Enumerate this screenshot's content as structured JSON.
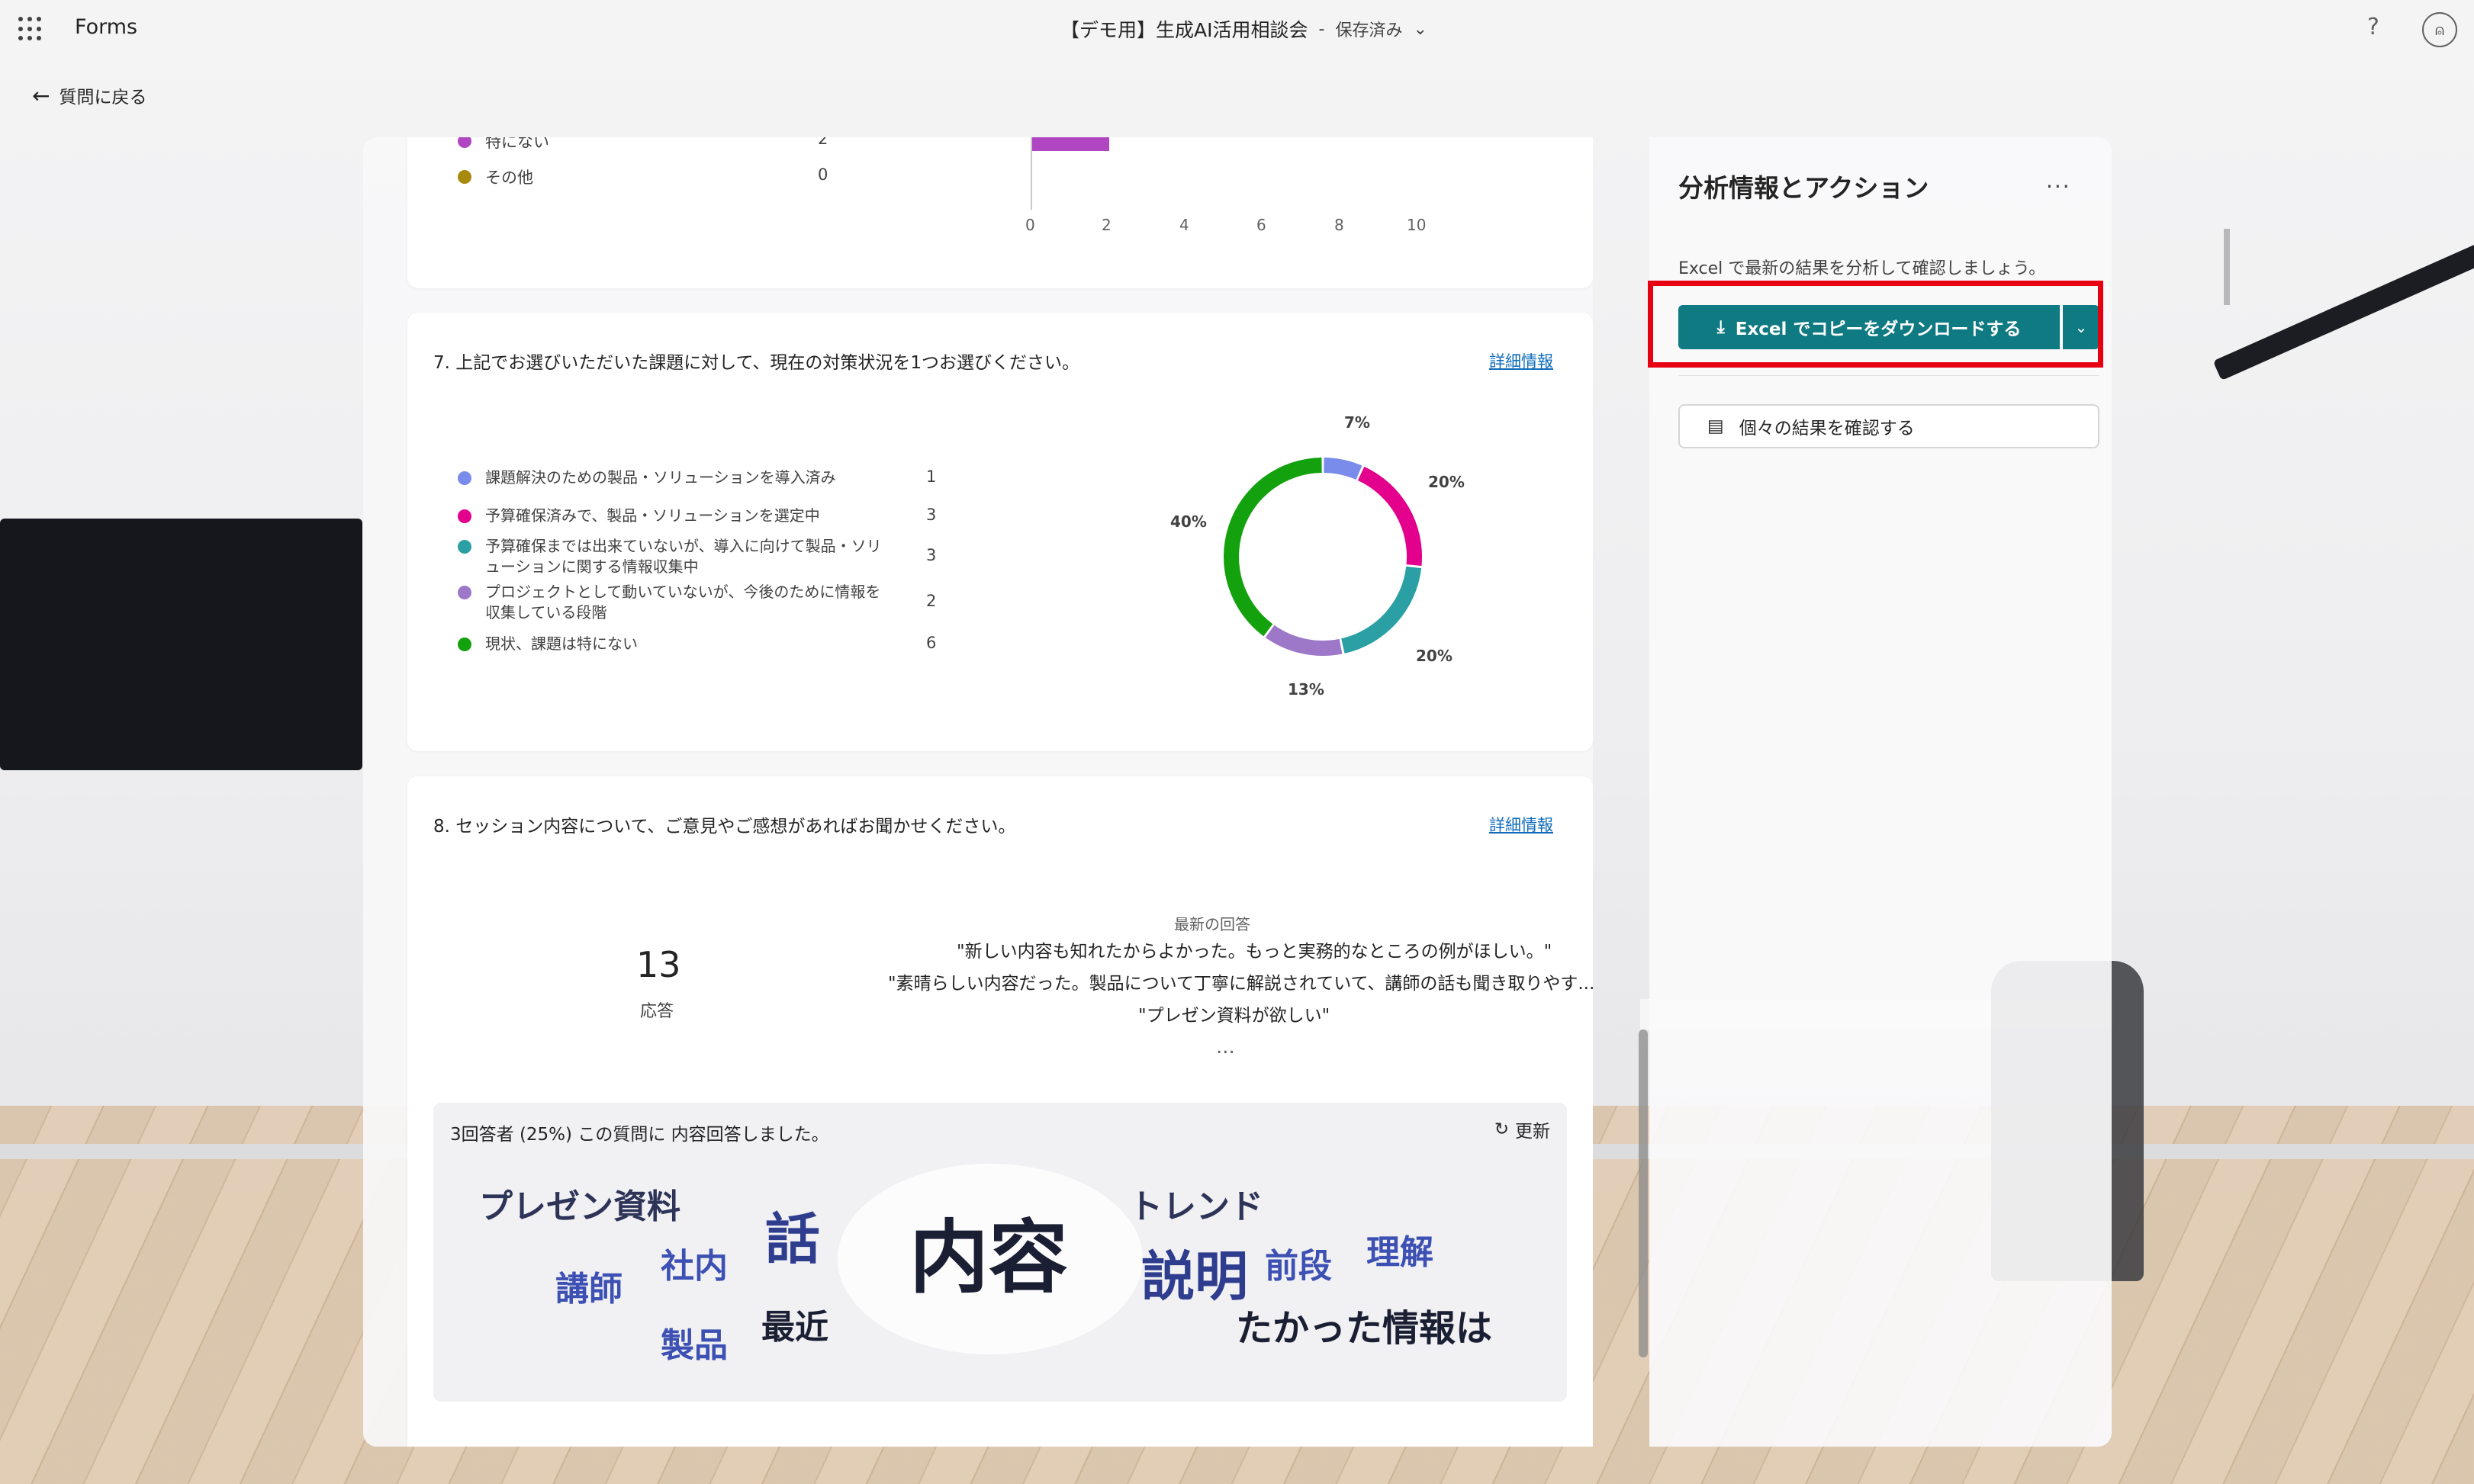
{
  "app": {
    "name": "Forms",
    "document_title": "【デモ用】生成AI活用相談会",
    "separator": "-",
    "save_status": "保存済み",
    "help_icon": "question-icon",
    "avatar_icon": "user-avatar-icon"
  },
  "nav": {
    "back_label": "質問に戻る"
  },
  "q6": {
    "legend": [
      {
        "label": "特にない",
        "count": "2",
        "color": "#b146c2"
      },
      {
        "label": "その他",
        "count": "0",
        "color": "#a7890c"
      }
    ],
    "axis_ticks": [
      "0",
      "2",
      "4",
      "6",
      "8",
      "10"
    ],
    "bar_value": 2,
    "bar_max": 10,
    "bar_color": "#b146c2"
  },
  "q7": {
    "title": "7. 上記でお選びいただいた課題に対して、現在の対策状況を1つお選びください。",
    "detail_link": "詳細情報",
    "legend": [
      {
        "label": "課題解決のための製品・ソリューションを導入済み",
        "count": "1",
        "color": "#7a8ceb"
      },
      {
        "label": "予算確保済みで、製品・ソリューションを選定中",
        "count": "3",
        "color": "#e3008c"
      },
      {
        "label": "予算確保までは出来ていないが、導入に向けて製品・ソリューションに関する情報収集中",
        "count": "3",
        "color": "#2aa0a4"
      },
      {
        "label": "プロジェクトとして動いていないが、今後のために情報を収集している段階",
        "count": "2",
        "color": "#9e78c8"
      },
      {
        "label": "現状、課題は特にない",
        "count": "6",
        "color": "#13a10e"
      }
    ],
    "percent_labels": [
      "7%",
      "20%",
      "20%",
      "13%",
      "40%"
    ]
  },
  "q8": {
    "title": "8. セッション内容について、ご意見やご感想があればお聞かせください。",
    "detail_link": "詳細情報",
    "response_count": "13",
    "response_label": "応答",
    "latest_label": "最新の回答",
    "quotes": [
      "\"新しい内容も知れたからよかった。もっと実務的なところの例がほしい。\"",
      "\"素晴らしい内容だった。製品について丁寧に解説されていて、講師の話も聞き取りやす...\"",
      "\"プレゼン資料が欲しい\""
    ],
    "more": "...",
    "wordcloud": {
      "summary": "3回答者 (25%) この質問に 内容回答しました。",
      "refresh_label": "更新",
      "words": [
        "プレゼン資料",
        "話",
        "内容",
        "トレンド",
        "講師",
        "社内",
        "説明",
        "前段",
        "理解",
        "製品",
        "最近",
        "たかった情報は"
      ]
    }
  },
  "side": {
    "title": "分析情報とアクション",
    "more": "...",
    "description": "Excel で最新の結果を分析して確認しましょう。",
    "excel_button": "Excel でコピーをダウンロードする",
    "individual_button": "個々の結果を確認する",
    "accent": "#0f7a82",
    "highlight_color": "#e60012"
  }
}
